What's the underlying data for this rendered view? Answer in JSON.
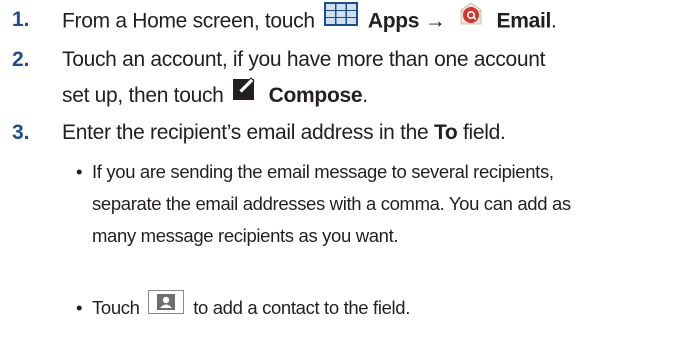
{
  "steps": [
    {
      "number": "1.",
      "text_before": "From a Home screen, touch",
      "apps_label": "Apps",
      "arrow": "→",
      "email_label": "Email",
      "end": "."
    },
    {
      "number": "2.",
      "line1": "Touch an account, if you have more than one account",
      "line2_before": "set up, then touch",
      "compose_label": "Compose",
      "end": "."
    },
    {
      "number": "3.",
      "text_before": "Enter the recipient’s email address in the",
      "to_label": "To",
      "text_after": "field."
    }
  ],
  "bullets": [
    {
      "dot": "•",
      "lines": [
        "If you are sending the email message to several recipients,",
        "separate the email addresses with a comma. You can add as",
        "many message recipients as you want."
      ]
    },
    {
      "dot": "•",
      "before": "Touch",
      "after": "to add a contact to the field."
    }
  ],
  "icons": {
    "apps": "apps-grid-icon",
    "email": "email-at-icon",
    "compose": "compose-pencil-icon",
    "contact": "contact-card-icon"
  },
  "colors": {
    "step_number": "#1f4e8c",
    "apps_icon": "#1f4e8c",
    "email_icon": "#d9332a",
    "text": "#231f20"
  }
}
